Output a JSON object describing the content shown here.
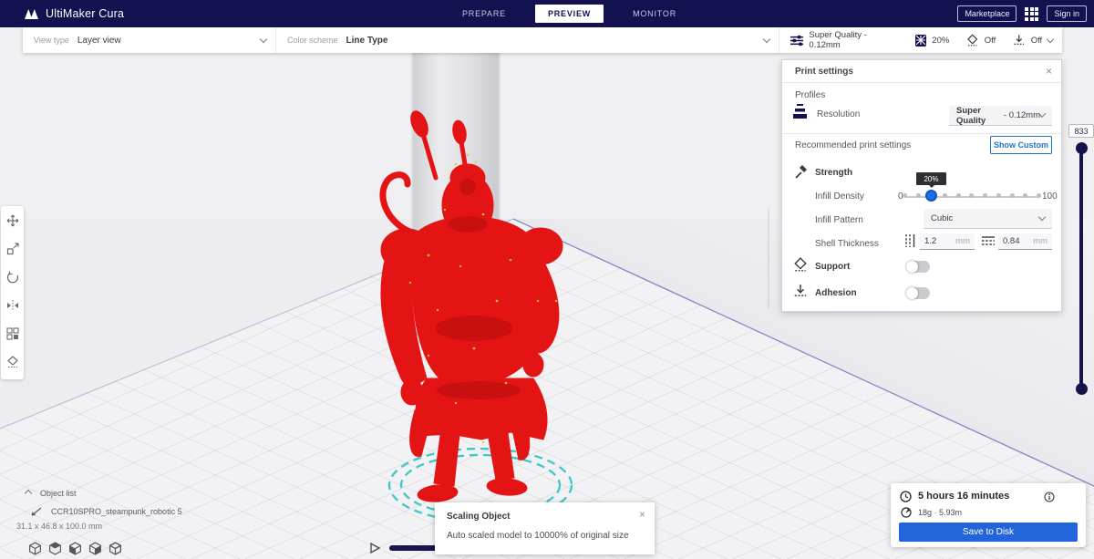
{
  "topbar": {
    "app_name": "UltiMaker Cura",
    "tabs": [
      {
        "label": "PREPARE",
        "active": false
      },
      {
        "label": "PREVIEW",
        "active": true
      },
      {
        "label": "MONITOR",
        "active": false
      }
    ],
    "marketplace_label": "Marketplace",
    "signin_label": "Sign in"
  },
  "view_toolbar": {
    "view_type_label": "View type",
    "view_type_value": "Layer view",
    "color_scheme_label": "Color scheme",
    "color_scheme_value": "Line Type"
  },
  "settings_summary": {
    "profile": "Super Quality - 0.12mm",
    "infill_value": "20%",
    "support_value": "Off",
    "adhesion_value": "Off"
  },
  "print_settings": {
    "title": "Print settings",
    "close": "×",
    "profiles_label": "Profiles",
    "resolution_label": "Resolution",
    "resolution_value_bold": "Super Quality",
    "resolution_value_suffix": " - 0.12mm",
    "recommended_label": "Recommended print settings",
    "show_custom_label": "Show Custom",
    "strength_label": "Strength",
    "infill_density_label": "Infill Density",
    "infill_min": "0",
    "infill_max": "100",
    "infill_value": "20%",
    "infill_pattern_label": "Infill Pattern",
    "infill_pattern_value": "Cubic",
    "shell_thickness_label": "Shell Thickness",
    "wall_thickness_value": "1.2",
    "wall_unit": "mm",
    "top_bottom_value": "0.84",
    "top_bottom_unit": "mm",
    "support_label": "Support",
    "adhesion_label": "Adhesion"
  },
  "layer_slider": {
    "current_layer": "833"
  },
  "object_list": {
    "title": "Object list",
    "item_name": "CCR10SPRO_steampunk_robotic 5",
    "dimensions": "31.1 x 46.8 x 100.0 mm"
  },
  "notification": {
    "title": "Scaling Object",
    "body": "Auto scaled model to 10000% of original size",
    "close": "×"
  },
  "output_panel": {
    "print_time": "5 hours 16 minutes",
    "material_usage": "18g · 5.93m",
    "save_button_label": "Save to Disk"
  },
  "colors": {
    "topbar_navy": "#131150",
    "accent_blue": "#2264d9",
    "link_blue": "#1f74c0",
    "model_red": "#e41414",
    "brim_teal": "#34c6c3"
  }
}
